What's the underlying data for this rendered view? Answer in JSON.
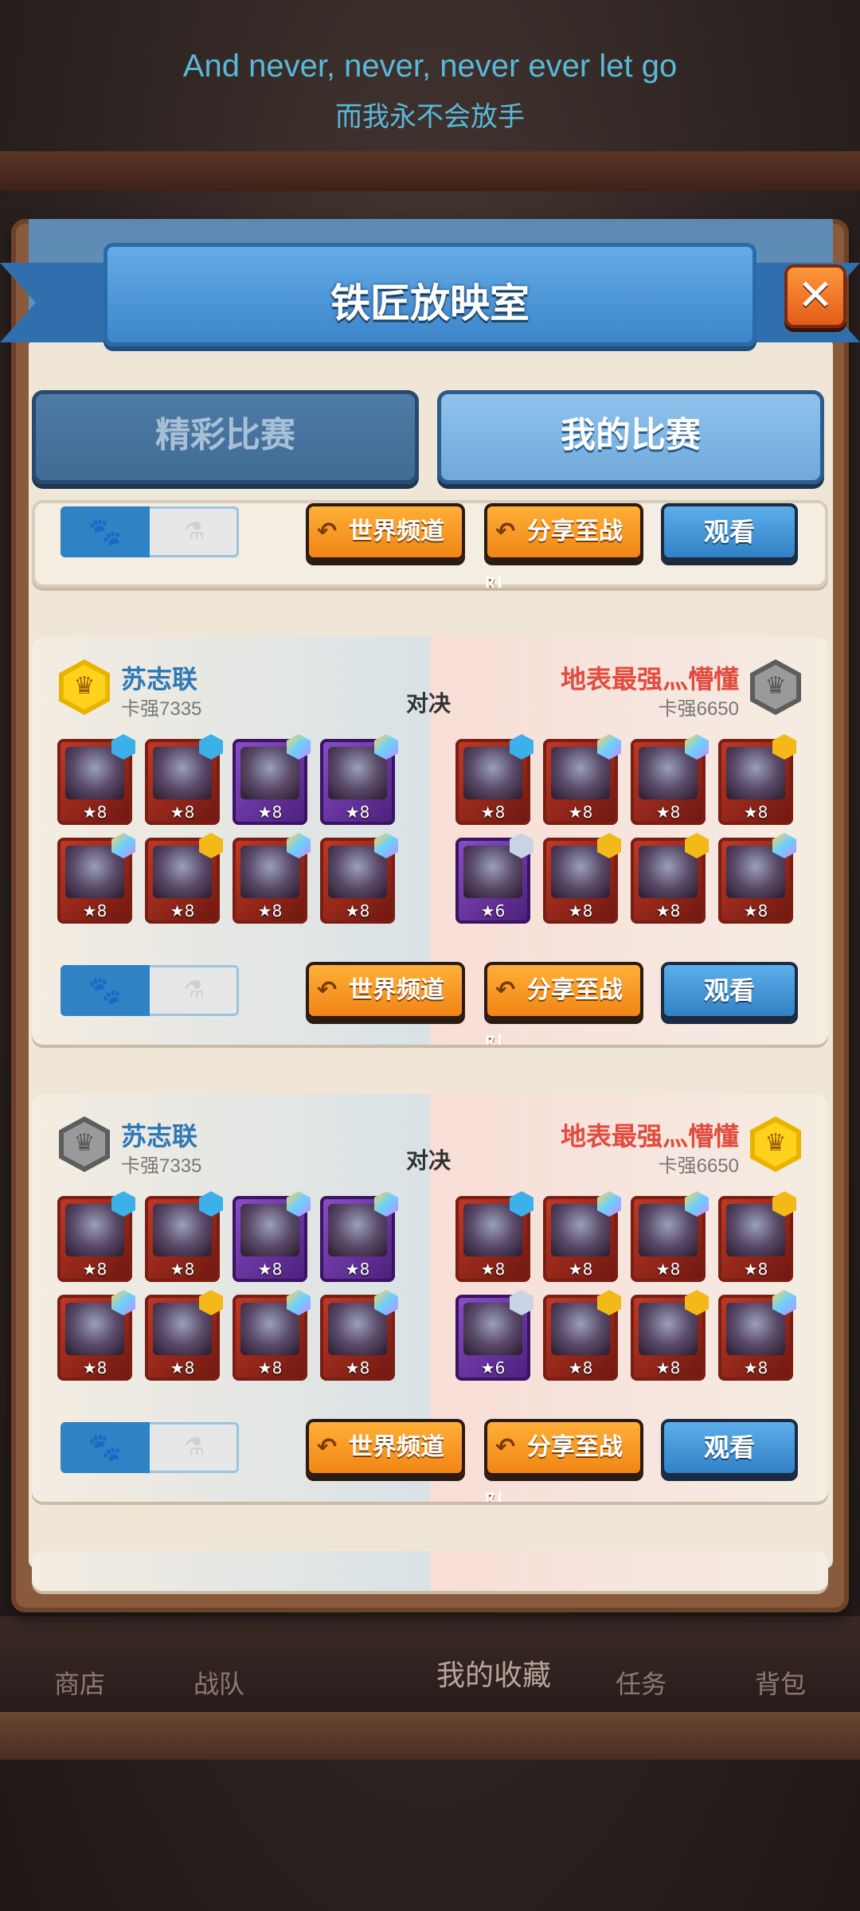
{
  "lyrics": {
    "english": "And never, never, never ever let go",
    "chinese": "而我永不会放手"
  },
  "dialog": {
    "title": "铁匠放映室",
    "close_symbol": "✕"
  },
  "tabs": [
    {
      "label": "精彩比赛",
      "active": false
    },
    {
      "label": "我的比赛",
      "active": true
    }
  ],
  "buttons": {
    "world_channel": "世界频道",
    "share_team": "分享至战队",
    "watch": "观看",
    "back_arrow": "↶"
  },
  "toggle": {
    "paw": "🐾",
    "potion": "⚗"
  },
  "matches": [
    {
      "left": {
        "name": "苏志联",
        "power": "卡强7335",
        "badge": "gold"
      },
      "right": {
        "name": "地表最强灬懵懂",
        "power": "卡强6650",
        "badge": "grey"
      },
      "vs": "对决",
      "left_units": [
        "★8",
        "★8",
        "★8",
        "★8",
        "★8",
        "★8",
        "★8",
        "★8"
      ],
      "right_units": [
        "★8",
        "★8",
        "★8",
        "★8",
        "★6",
        "★8",
        "★8",
        "★8"
      ]
    },
    {
      "left": {
        "name": "苏志联",
        "power": "卡强7335",
        "badge": "grey"
      },
      "right": {
        "name": "地表最强灬懵懂",
        "power": "卡强6650",
        "badge": "gold"
      },
      "vs": "对决",
      "left_units": [
        "★8",
        "★8",
        "★8",
        "★8",
        "★8",
        "★8",
        "★8",
        "★8"
      ],
      "right_units": [
        "★8",
        "★8",
        "★8",
        "★8",
        "★6",
        "★8",
        "★8",
        "★8"
      ]
    }
  ],
  "bottom_nav": {
    "shop": "商店",
    "team": "战队",
    "collection": "我的收藏",
    "task": "任务",
    "bag": "背包"
  },
  "colors": {
    "lyric": "#59b9d8",
    "left_player": "#2f78b8",
    "right_player": "#e24b3e",
    "orange_button": "#f08212",
    "blue_button": "#2f7ec4"
  }
}
